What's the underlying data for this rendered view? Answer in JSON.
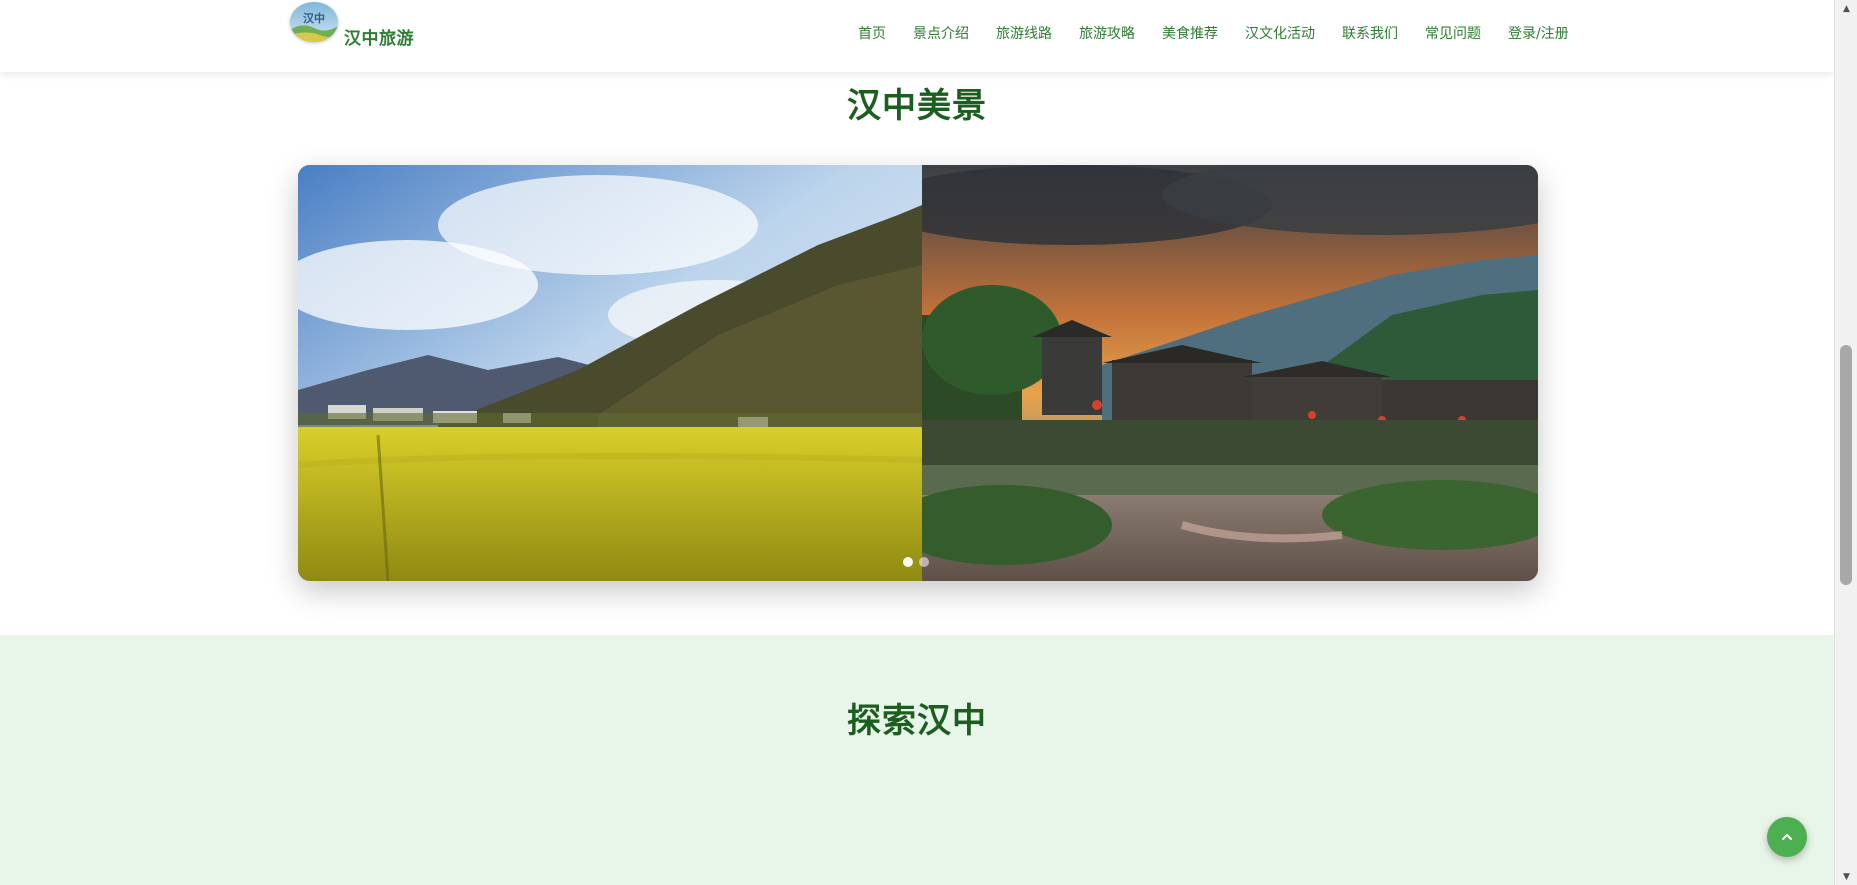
{
  "header": {
    "brand": "汉中旅游",
    "logo_text": "汉中",
    "nav": [
      {
        "label": "首页"
      },
      {
        "label": "景点介绍"
      },
      {
        "label": "旅游线路"
      },
      {
        "label": "旅游攻略"
      },
      {
        "label": "美食推荐"
      },
      {
        "label": "汉文化活动"
      },
      {
        "label": "联系我们"
      },
      {
        "label": "常见问题"
      },
      {
        "label": "登录/注册"
      }
    ]
  },
  "gallery": {
    "title": "汉中美景",
    "slides": [
      {
        "description": "rapeseed-field-mountain-village"
      },
      {
        "description": "ancient-town-sunset-river"
      }
    ],
    "active_dot": 0
  },
  "explore": {
    "title": "探索汉中"
  },
  "back_to_top": {
    "icon": "chevron-up-icon"
  },
  "colors": {
    "primary_green": "#2e7d32",
    "title_green": "#1b5e20",
    "section_bg": "#e8f5e9",
    "fab_green": "#4caf50"
  }
}
